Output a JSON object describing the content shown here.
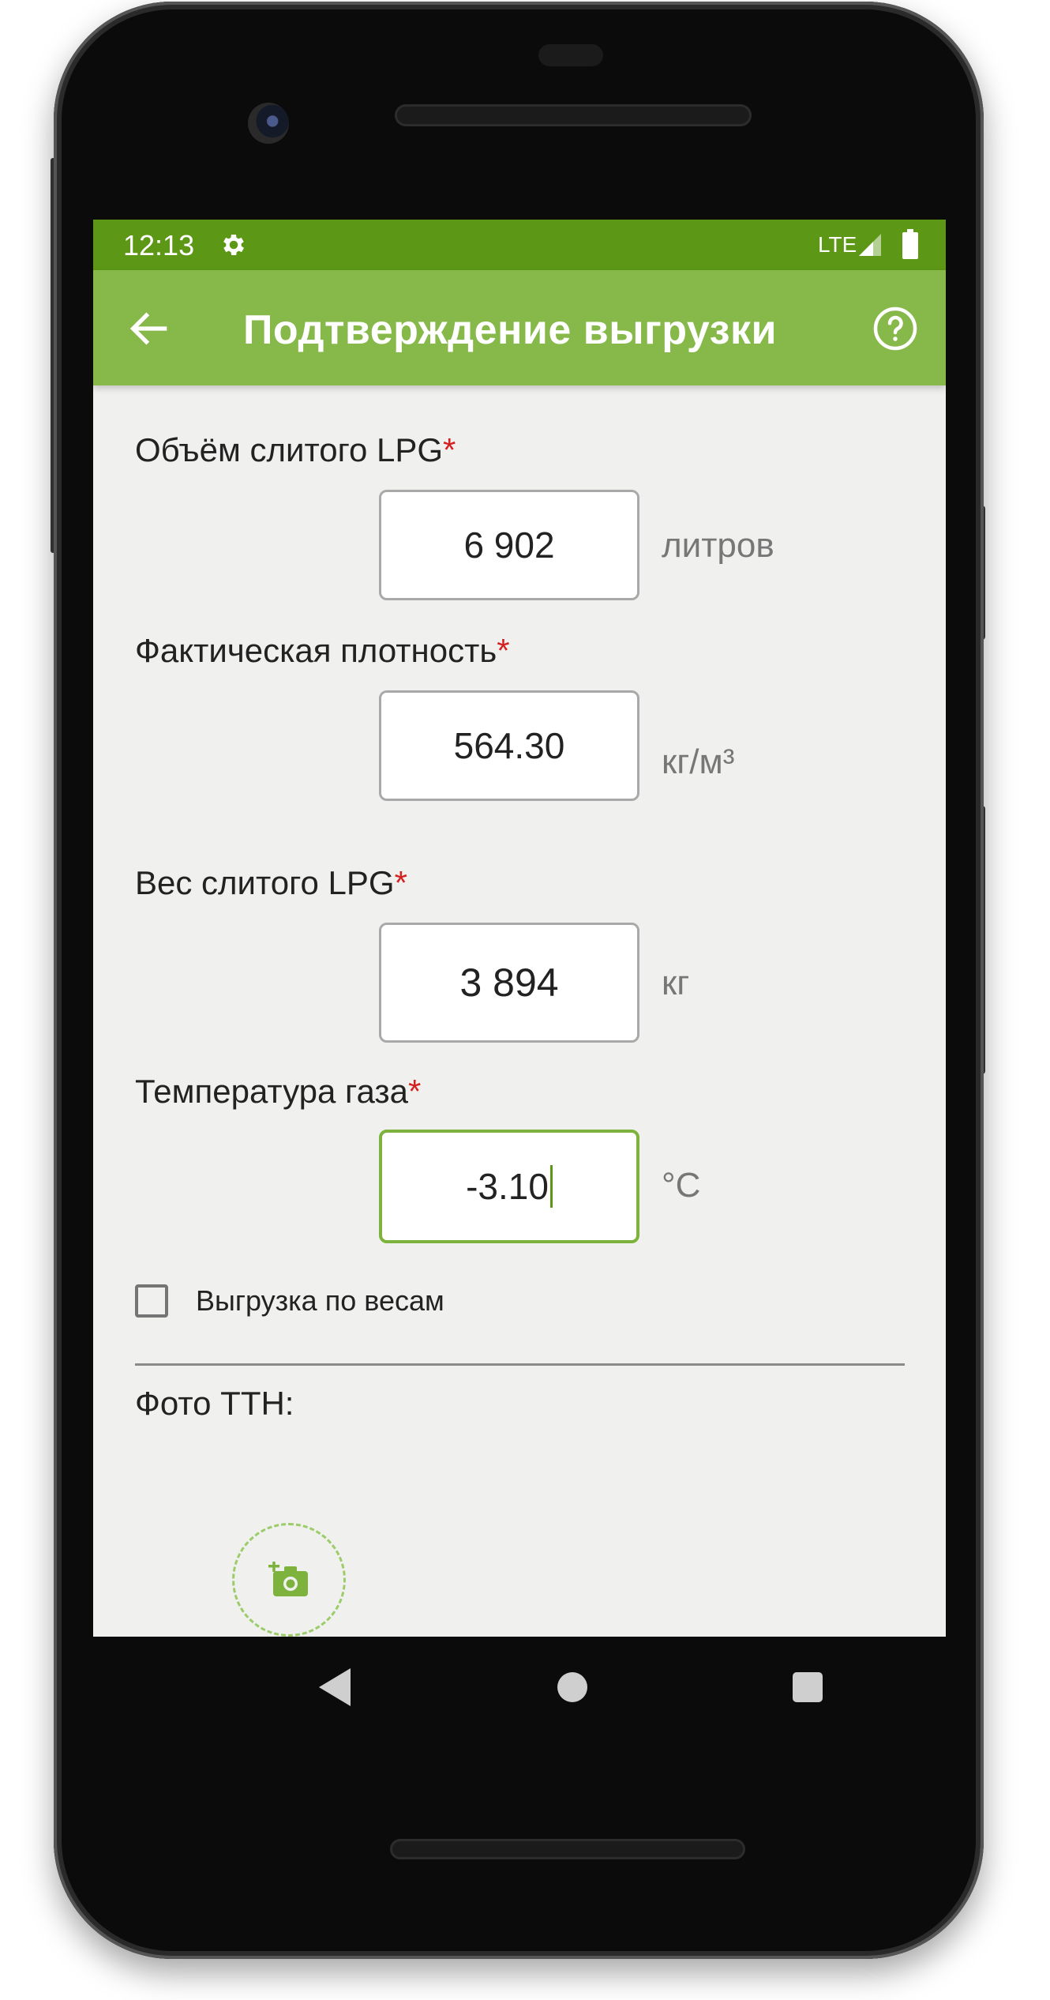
{
  "status_bar": {
    "time": "12:13",
    "network": "LTE",
    "icons": [
      "gear-icon",
      "signal-icon",
      "battery-icon"
    ]
  },
  "app_bar": {
    "title": "Подтверждение выгрузки",
    "icons": [
      "arrow-left-icon",
      "help-circle-icon"
    ]
  },
  "form": {
    "volume": {
      "label": "Объём слитого LPG",
      "required_mark": "*",
      "value": "6 902",
      "unit": "литров"
    },
    "density": {
      "label": "Фактическая плотность",
      "required_mark": "*",
      "value": "564.30",
      "unit": "кг/м³"
    },
    "weight": {
      "label": "Вес слитого LPG",
      "required_mark": "*",
      "value": "3 894",
      "unit": "кг"
    },
    "temperature": {
      "label": "Температура газа",
      "required_mark": "*",
      "value": "-3.10",
      "unit": "°C"
    },
    "by_weight": {
      "label": "Выгрузка по весам",
      "checked": false
    },
    "photo": {
      "label": "Фото ТТН:",
      "add_icon": "add-photo-icon"
    }
  },
  "nav_bar": {
    "icons": [
      "nav-back-icon",
      "nav-home-icon",
      "nav-recents-icon"
    ]
  },
  "colors": {
    "status_bar": "#5c9715",
    "app_bar": "#86b84a",
    "required": "#d32020",
    "accent": "#7db33c",
    "screen_bg": "#f0f1ef"
  }
}
